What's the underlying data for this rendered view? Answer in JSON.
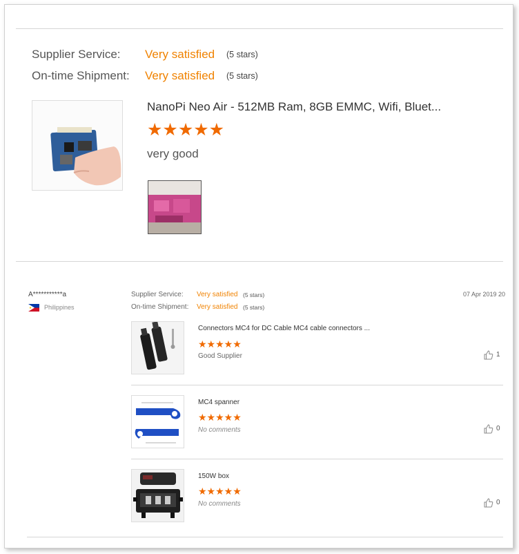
{
  "featured_review": {
    "supplier_service_label": "Supplier Service:",
    "supplier_service_value": "Very satisfied",
    "supplier_service_stars": "(5 stars)",
    "shipment_label": "On-time Shipment:",
    "shipment_value": "Very satisfied",
    "shipment_stars": "(5 stars)",
    "product_title": "NanoPi Neo Air - 512MB Ram, 8GB EMMC, Wifi, Bluet...",
    "rating": 5,
    "stars": "★★★★★",
    "comment": "very good"
  },
  "review": {
    "user": "A***********a",
    "country": "Philippines",
    "date": "07 Apr 2019 20",
    "supplier_service_label": "Supplier Service:",
    "supplier_service_value": "Very satisfied",
    "supplier_service_stars": "(5 stars)",
    "shipment_label": "On-time Shipment:",
    "shipment_value": "Very satisfied",
    "shipment_stars": "(5 stars)",
    "items": [
      {
        "title": "Connectors MC4 for DC Cable MC4 cable connectors ...",
        "rating": 5,
        "stars": "★★★★★",
        "comment": "Good Supplier",
        "likes": "1"
      },
      {
        "title": "MC4 spanner",
        "rating": 5,
        "stars": "★★★★★",
        "comment": "No comments",
        "likes": "0"
      },
      {
        "title": "150W box",
        "rating": 5,
        "stars": "★★★★★",
        "comment": "No comments",
        "likes": "0"
      }
    ]
  },
  "colors": {
    "accent": "#f08200",
    "star": "#f06a00"
  }
}
